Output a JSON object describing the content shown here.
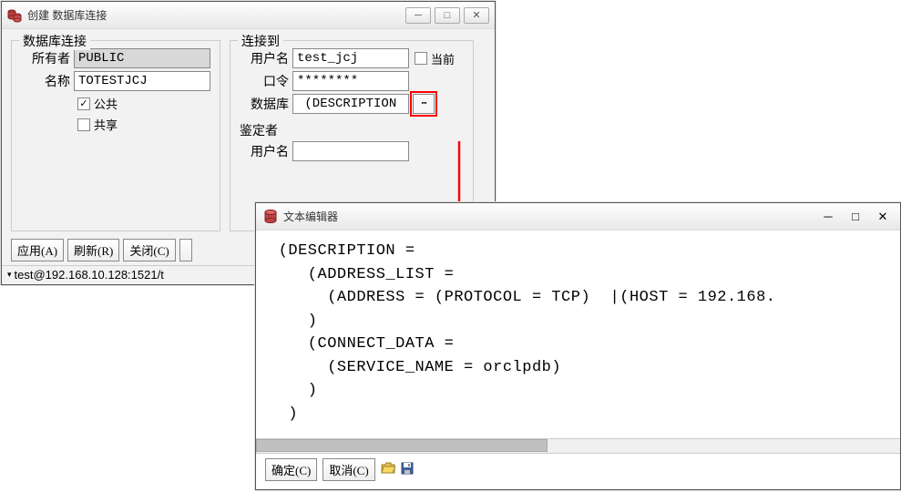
{
  "main_window": {
    "title": "创建 数据库连接",
    "fieldset_left": {
      "legend": "数据库连接",
      "owner_label": "所有者",
      "owner_value": "PUBLIC",
      "name_label": "名称",
      "name_value": "TOTESTJCJ",
      "public_label": "公共",
      "public_checked": true,
      "share_label": "共享",
      "share_checked": false
    },
    "fieldset_right": {
      "legend": "连接到",
      "user_label": "用户名",
      "user_value": "test_jcj",
      "current_label": "当前",
      "current_checked": false,
      "pwd_label": "口令",
      "pwd_value": "********",
      "db_label": "数据库",
      "db_value": " (DESCRIPTION",
      "browse_label": "⋯",
      "auth_label": "鉴定者",
      "auth_user_label": "用户名",
      "auth_user_value": ""
    },
    "buttons": {
      "apply": "应用(A)",
      "refresh": "刷新(R)",
      "close": "关闭(C)"
    },
    "status": "test@192.168.10.128:1521/t"
  },
  "editor_window": {
    "title": "文本编辑器",
    "content": " (DESCRIPTION =\n    (ADDRESS_LIST =\n      (ADDRESS = (PROTOCOL = TCP)  |(HOST = 192.168.\n    )\n    (CONNECT_DATA =\n      (SERVICE_NAME = orclpdb)\n    )\n  )",
    "buttons": {
      "ok": "确定(C)",
      "cancel": "取消(C)"
    }
  }
}
